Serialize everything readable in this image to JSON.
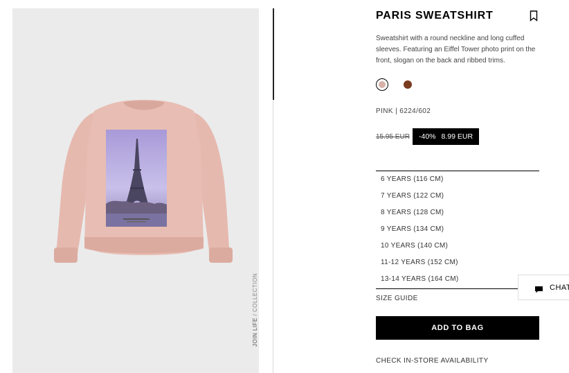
{
  "product": {
    "title": "PARIS SWEATSHIRT",
    "description": "Sweatshirt with a round neckline and long cuffed sleeves. Featuring an Eiffel Tower photo print on the front, slogan on the back and ribbed trims.",
    "color_ref": "PINK | 6224/602",
    "price_old": "15.95 EUR",
    "discount": "-40%",
    "price_new": "8.99 EUR",
    "colors": [
      "#d7b1a8",
      "#7a3b1f"
    ],
    "image_caption_bold": "JOIN LIFE",
    "image_caption": " / COLLECTION"
  },
  "sizes": [
    "6 YEARS (116 CM)",
    "7 YEARS (122 CM)",
    "8 YEARS (128 CM)",
    "9 YEARS (134 CM)",
    "10 YEARS (140 CM)",
    "11-12 YEARS (152 CM)",
    "13-14 YEARS (164 CM)"
  ],
  "actions": {
    "size_guide": "SIZE GUIDE",
    "add_to_bag": "ADD TO BAG",
    "store_availability": "CHECK IN-STORE AVAILABILITY",
    "chat": "CHAT"
  },
  "icons": {
    "bookmark": "bookmark-icon",
    "chat": "chat-bubble-icon"
  }
}
